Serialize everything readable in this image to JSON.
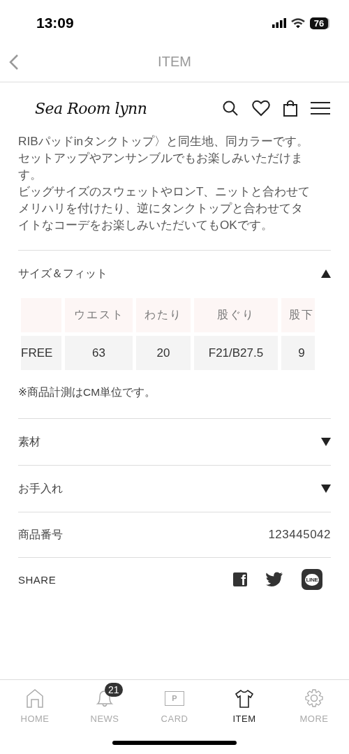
{
  "status_bar": {
    "time": "13:09",
    "battery": "76"
  },
  "header": {
    "title": "ITEM"
  },
  "brand": {
    "logo": "Sea Room lynn"
  },
  "description": [
    "RIBパッドinタンクトップ〉と同生地、同カラーです。セットアップやアンサンブルでもお楽しみいただけます。",
    "ビッグサイズのスウェットやロンT、ニットと合わせてメリハリを付けたり、逆にタンクトップと合わせてタイトなコーデをお楽しみいただいてもOKです。"
  ],
  "size_fit": {
    "title": "サイズ＆フィット",
    "expanded": true,
    "table": {
      "columns": [
        "ウエスト",
        "わたり",
        "股ぐり",
        "股下"
      ],
      "rows": [
        {
          "size": "FREE",
          "cells": [
            "63",
            "20",
            "F21/B27.5",
            "9"
          ]
        }
      ]
    },
    "note": "※商品計測はCM単位です。"
  },
  "sections": [
    {
      "title": "素材",
      "expanded": false
    },
    {
      "title": "お手入れ",
      "expanded": false
    }
  ],
  "product_number": {
    "label": "商品番号",
    "value": "123445042"
  },
  "share": {
    "label": "SHARE",
    "icons": [
      {
        "kind": "facebook",
        "glyph": "f"
      },
      {
        "kind": "twitter"
      },
      {
        "kind": "line",
        "glyph": "LINE"
      }
    ]
  },
  "tab_bar": [
    {
      "kind": "home",
      "label": "HOME",
      "selected": false
    },
    {
      "kind": "news",
      "label": "NEWS",
      "badge": "21",
      "selected": false
    },
    {
      "kind": "card",
      "label": "CARD",
      "glyph": "P",
      "selected": false
    },
    {
      "kind": "item",
      "label": "ITEM",
      "selected": true
    },
    {
      "kind": "more",
      "label": "MORE",
      "selected": false
    }
  ]
}
